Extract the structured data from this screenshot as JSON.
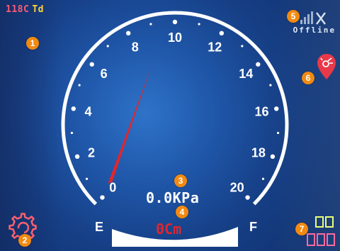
{
  "status_bar": {
    "vehicle_code": "118C",
    "mode": "Td",
    "connection_status": "Offline"
  },
  "gauge": {
    "scale_labels": [
      "0",
      "2",
      "4",
      "6",
      "8",
      "10",
      "12",
      "14",
      "16",
      "18",
      "20"
    ],
    "scale_min": 0,
    "scale_max": 20,
    "needle_value": 0,
    "empty_label": "E",
    "full_label": "F"
  },
  "readouts": {
    "pressure": "0.0KPa",
    "distance": "0Cm"
  },
  "markers": [
    "1",
    "2",
    "3",
    "4",
    "5",
    "6",
    "7"
  ],
  "icons": {
    "settings": "gear-icon",
    "alert": "temperature-alert-icon",
    "signal": "signal-bars-icon",
    "extra_indicators": "segment-indicators-icon"
  },
  "colors": {
    "accent_marker": "#f28a12",
    "alert_pin": "#e8394a",
    "needle": "#e0262d",
    "distance_text": "#e0262d",
    "status_code": "#ff5a73",
    "status_mode": "#ffd23a",
    "settings_icon": "#ff5f6e"
  }
}
